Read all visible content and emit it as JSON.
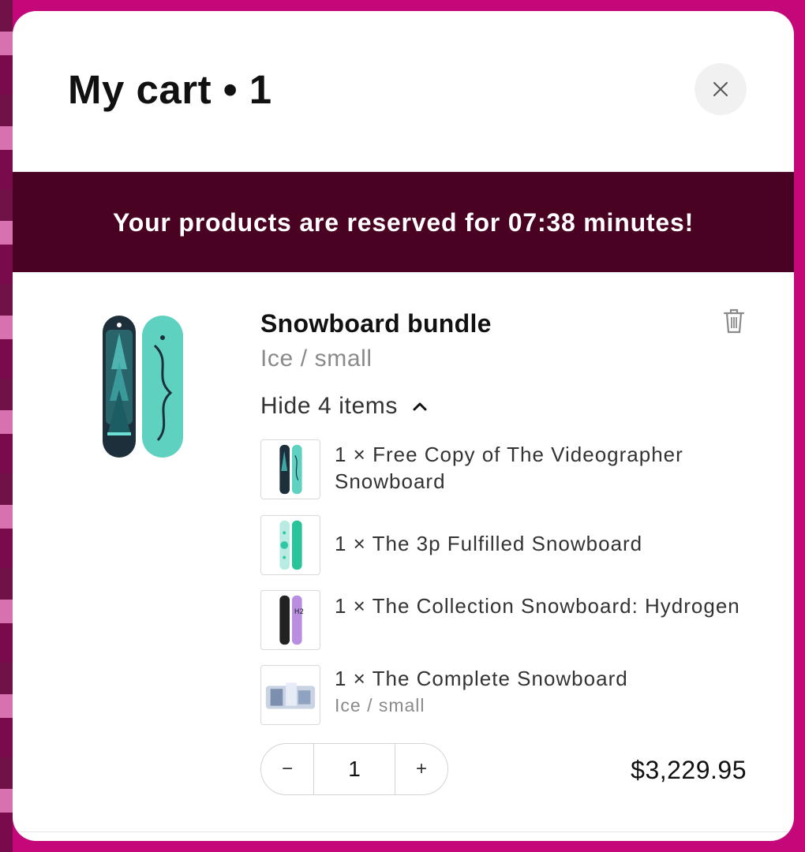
{
  "cart": {
    "title": "My cart • 1",
    "reservation_banner": "Your products are reserved for 07:38 minutes!",
    "product": {
      "name": "Snowboard bundle",
      "variant": "Ice / small",
      "toggle_label": "Hide 4 items",
      "bundle_items": [
        {
          "text": "1 × Free Copy of The Videographer Snowboard",
          "sub": ""
        },
        {
          "text": "1 × The 3p Fulfilled Snowboard",
          "sub": ""
        },
        {
          "text": "1 × The Collection Snowboard: Hydrogen",
          "sub": ""
        },
        {
          "text": "1 × The Complete Snowboard",
          "sub": "Ice / small"
        }
      ],
      "quantity": "1",
      "decrease_label": "−",
      "increase_label": "+",
      "price": "$3,229.95"
    }
  },
  "colors": {
    "backdrop": "#c4087a",
    "banner": "#4a0223",
    "teal": "#5ed1c0",
    "dark_board": "#1e2f3c",
    "lavender": "#b98ee0"
  },
  "icons": {
    "close": "close-icon",
    "remove": "trash-icon",
    "toggle": "chevron-up-icon"
  }
}
